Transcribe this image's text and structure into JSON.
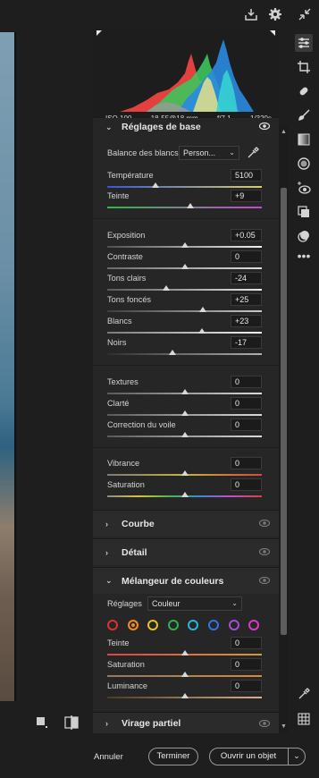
{
  "histogram": {
    "iso": "ISO 100",
    "lens": "18-55@18 mm",
    "aperture": "f/7,1",
    "shutter": "1/320s"
  },
  "basic": {
    "title": "Réglages de base",
    "wb_label": "Balance des blancs",
    "wb_value": "Person...",
    "temperature": {
      "label": "Température",
      "value": "5100",
      "pos": 0.31
    },
    "tint": {
      "label": "Teinte",
      "value": "+9",
      "pos": 0.54
    },
    "exposure": {
      "label": "Exposition",
      "value": "+0.05",
      "pos": 0.5
    },
    "contrast": {
      "label": "Contraste",
      "value": "0",
      "pos": 0.5
    },
    "highlights": {
      "label": "Tons clairs",
      "value": "-24",
      "pos": 0.38
    },
    "shadows": {
      "label": "Tons foncés",
      "value": "+25",
      "pos": 0.62
    },
    "whites": {
      "label": "Blancs",
      "value": "+23",
      "pos": 0.61
    },
    "blacks": {
      "label": "Noirs",
      "value": "-17",
      "pos": 0.42
    },
    "texture": {
      "label": "Textures",
      "value": "0",
      "pos": 0.5
    },
    "clarity": {
      "label": "Clarté",
      "value": "0",
      "pos": 0.5
    },
    "dehaze": {
      "label": "Correction du voile",
      "value": "0",
      "pos": 0.5
    },
    "vibrance": {
      "label": "Vibrance",
      "value": "0",
      "pos": 0.5
    },
    "saturation": {
      "label": "Saturation",
      "value": "0",
      "pos": 0.5
    }
  },
  "sections": {
    "curve": "Courbe",
    "detail": "Détail",
    "mixer": "Mélangeur de couleurs",
    "split": "Virage partiel"
  },
  "mixer": {
    "settings_label": "Réglages",
    "settings_value": "Couleur",
    "swatch_colors": [
      "#e0322e",
      "#f08a1c",
      "#e8c21d",
      "#2fb24a",
      "#29b7d6",
      "#2f74e6",
      "#a24fd8",
      "#d83ac9"
    ],
    "hue": {
      "label": "Teinte",
      "value": "0",
      "pos": 0.5
    },
    "saturation": {
      "label": "Saturation",
      "value": "0",
      "pos": 0.5
    },
    "luminance": {
      "label": "Luminance",
      "value": "0",
      "pos": 0.5
    }
  },
  "footer": {
    "cancel": "Annuler",
    "done": "Terminer",
    "open": "Ouvrir un objet"
  }
}
